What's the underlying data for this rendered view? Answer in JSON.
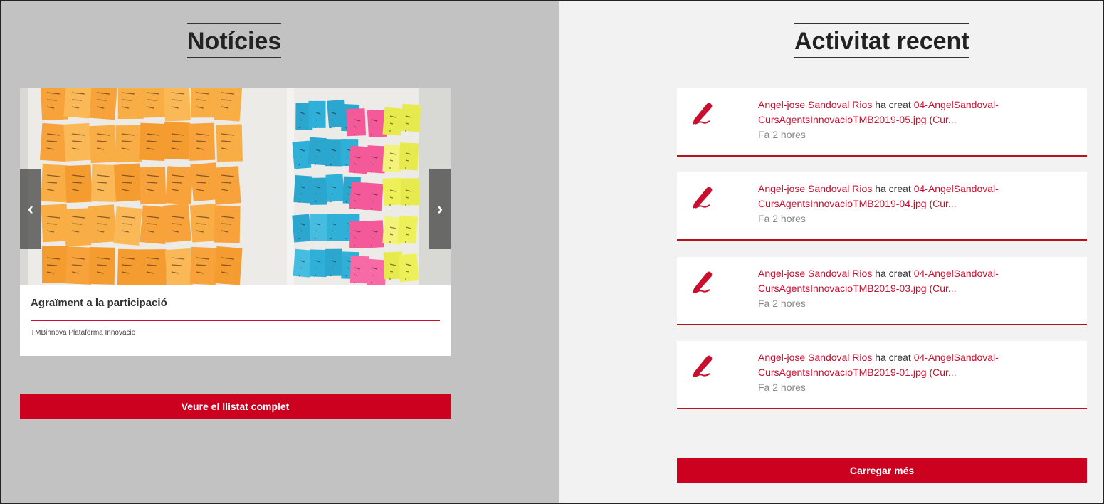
{
  "news": {
    "title": "Notícies",
    "card": {
      "title": "Agraïment a la participació",
      "source": "TMBinnova Plataforma Innovacio"
    },
    "prev_icon": "chevron-left-icon",
    "next_icon": "chevron-right-icon",
    "see_all_label": "Veure el llistat complet"
  },
  "activity": {
    "title": "Activitat recent",
    "icon": "pencil-icon",
    "items": [
      {
        "user": "Angel-jose Sandoval Rios",
        "action": " ha creat ",
        "file_line1": "04-AngelSandoval-",
        "file_line2": "CursAgentsInnovacioTMB2019-05.jpg (Cur...",
        "time": "Fa 2 hores"
      },
      {
        "user": "Angel-jose Sandoval Rios",
        "action": " ha creat ",
        "file_line1": "04-AngelSandoval-",
        "file_line2": "CursAgentsInnovacioTMB2019-04.jpg (Cur...",
        "time": "Fa 2 hores"
      },
      {
        "user": "Angel-jose Sandoval Rios",
        "action": " ha creat ",
        "file_line1": "04-AngelSandoval-",
        "file_line2": "CursAgentsInnovacioTMB2019-03.jpg (Cur...",
        "time": "Fa 2 hores"
      },
      {
        "user": "Angel-jose Sandoval Rios",
        "action": " ha creat ",
        "file_line1": "04-AngelSandoval-",
        "file_line2": "CursAgentsInnovacioTMB2019-01.jpg (Cur...",
        "time": "Fa 2 hores"
      }
    ],
    "load_more_label": "Carregar més"
  },
  "colors": {
    "accent": "#cc001f",
    "left_bg": "#c2c2c2",
    "right_bg": "#f2f2f2"
  }
}
